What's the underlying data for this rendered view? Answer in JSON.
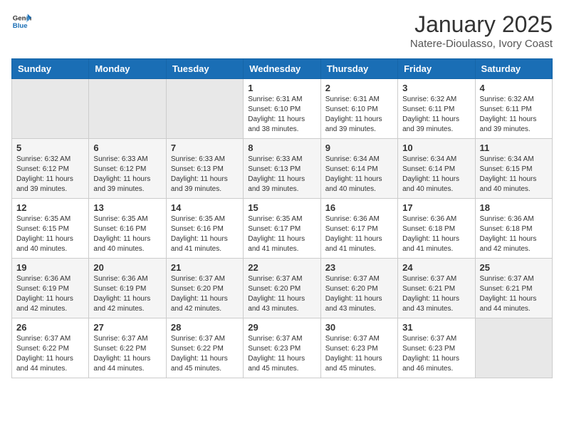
{
  "header": {
    "logo_general": "General",
    "logo_blue": "Blue",
    "title": "January 2025",
    "subtitle": "Natere-Dioulasso, Ivory Coast"
  },
  "weekdays": [
    "Sunday",
    "Monday",
    "Tuesday",
    "Wednesday",
    "Thursday",
    "Friday",
    "Saturday"
  ],
  "weeks": [
    [
      {
        "day": "",
        "info": ""
      },
      {
        "day": "",
        "info": ""
      },
      {
        "day": "",
        "info": ""
      },
      {
        "day": "1",
        "info": "Sunrise: 6:31 AM\nSunset: 6:10 PM\nDaylight: 11 hours and 38 minutes."
      },
      {
        "day": "2",
        "info": "Sunrise: 6:31 AM\nSunset: 6:10 PM\nDaylight: 11 hours and 39 minutes."
      },
      {
        "day": "3",
        "info": "Sunrise: 6:32 AM\nSunset: 6:11 PM\nDaylight: 11 hours and 39 minutes."
      },
      {
        "day": "4",
        "info": "Sunrise: 6:32 AM\nSunset: 6:11 PM\nDaylight: 11 hours and 39 minutes."
      }
    ],
    [
      {
        "day": "5",
        "info": "Sunrise: 6:32 AM\nSunset: 6:12 PM\nDaylight: 11 hours and 39 minutes."
      },
      {
        "day": "6",
        "info": "Sunrise: 6:33 AM\nSunset: 6:12 PM\nDaylight: 11 hours and 39 minutes."
      },
      {
        "day": "7",
        "info": "Sunrise: 6:33 AM\nSunset: 6:13 PM\nDaylight: 11 hours and 39 minutes."
      },
      {
        "day": "8",
        "info": "Sunrise: 6:33 AM\nSunset: 6:13 PM\nDaylight: 11 hours and 39 minutes."
      },
      {
        "day": "9",
        "info": "Sunrise: 6:34 AM\nSunset: 6:14 PM\nDaylight: 11 hours and 40 minutes."
      },
      {
        "day": "10",
        "info": "Sunrise: 6:34 AM\nSunset: 6:14 PM\nDaylight: 11 hours and 40 minutes."
      },
      {
        "day": "11",
        "info": "Sunrise: 6:34 AM\nSunset: 6:15 PM\nDaylight: 11 hours and 40 minutes."
      }
    ],
    [
      {
        "day": "12",
        "info": "Sunrise: 6:35 AM\nSunset: 6:15 PM\nDaylight: 11 hours and 40 minutes."
      },
      {
        "day": "13",
        "info": "Sunrise: 6:35 AM\nSunset: 6:16 PM\nDaylight: 11 hours and 40 minutes."
      },
      {
        "day": "14",
        "info": "Sunrise: 6:35 AM\nSunset: 6:16 PM\nDaylight: 11 hours and 41 minutes."
      },
      {
        "day": "15",
        "info": "Sunrise: 6:35 AM\nSunset: 6:17 PM\nDaylight: 11 hours and 41 minutes."
      },
      {
        "day": "16",
        "info": "Sunrise: 6:36 AM\nSunset: 6:17 PM\nDaylight: 11 hours and 41 minutes."
      },
      {
        "day": "17",
        "info": "Sunrise: 6:36 AM\nSunset: 6:18 PM\nDaylight: 11 hours and 41 minutes."
      },
      {
        "day": "18",
        "info": "Sunrise: 6:36 AM\nSunset: 6:18 PM\nDaylight: 11 hours and 42 minutes."
      }
    ],
    [
      {
        "day": "19",
        "info": "Sunrise: 6:36 AM\nSunset: 6:19 PM\nDaylight: 11 hours and 42 minutes."
      },
      {
        "day": "20",
        "info": "Sunrise: 6:36 AM\nSunset: 6:19 PM\nDaylight: 11 hours and 42 minutes."
      },
      {
        "day": "21",
        "info": "Sunrise: 6:37 AM\nSunset: 6:20 PM\nDaylight: 11 hours and 42 minutes."
      },
      {
        "day": "22",
        "info": "Sunrise: 6:37 AM\nSunset: 6:20 PM\nDaylight: 11 hours and 43 minutes."
      },
      {
        "day": "23",
        "info": "Sunrise: 6:37 AM\nSunset: 6:20 PM\nDaylight: 11 hours and 43 minutes."
      },
      {
        "day": "24",
        "info": "Sunrise: 6:37 AM\nSunset: 6:21 PM\nDaylight: 11 hours and 43 minutes."
      },
      {
        "day": "25",
        "info": "Sunrise: 6:37 AM\nSunset: 6:21 PM\nDaylight: 11 hours and 44 minutes."
      }
    ],
    [
      {
        "day": "26",
        "info": "Sunrise: 6:37 AM\nSunset: 6:22 PM\nDaylight: 11 hours and 44 minutes."
      },
      {
        "day": "27",
        "info": "Sunrise: 6:37 AM\nSunset: 6:22 PM\nDaylight: 11 hours and 44 minutes."
      },
      {
        "day": "28",
        "info": "Sunrise: 6:37 AM\nSunset: 6:22 PM\nDaylight: 11 hours and 45 minutes."
      },
      {
        "day": "29",
        "info": "Sunrise: 6:37 AM\nSunset: 6:23 PM\nDaylight: 11 hours and 45 minutes."
      },
      {
        "day": "30",
        "info": "Sunrise: 6:37 AM\nSunset: 6:23 PM\nDaylight: 11 hours and 45 minutes."
      },
      {
        "day": "31",
        "info": "Sunrise: 6:37 AM\nSunset: 6:23 PM\nDaylight: 11 hours and 46 minutes."
      },
      {
        "day": "",
        "info": ""
      }
    ]
  ]
}
